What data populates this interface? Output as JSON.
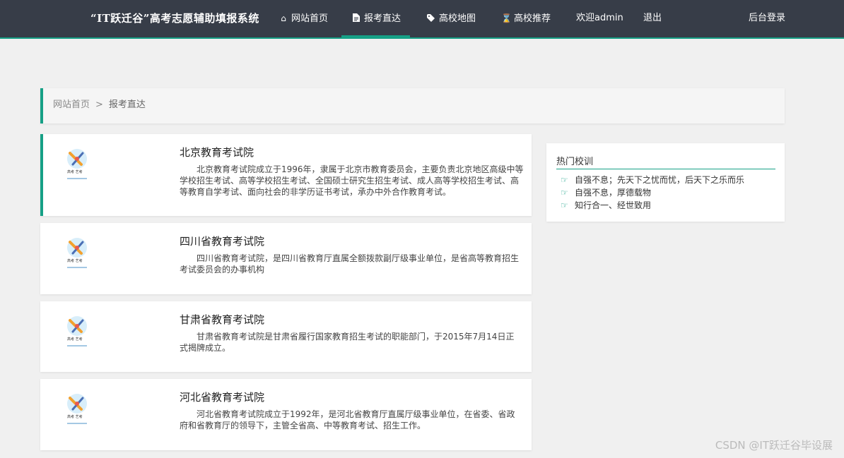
{
  "brand": "“IT跃迁谷”高考志愿辅助填报系统",
  "nav": [
    {
      "label": "网站首页",
      "icon": "home-icon"
    },
    {
      "label": "报考直达",
      "icon": "file-icon",
      "active": true
    },
    {
      "label": "高校地图",
      "icon": "tag-icon"
    },
    {
      "label": "高校推荐",
      "icon": "hourglass-icon"
    },
    {
      "label": "欢迎admin",
      "icon": ""
    },
    {
      "label": "退出",
      "icon": ""
    },
    {
      "label": "后台登录",
      "icon": ""
    }
  ],
  "breadcrumb": {
    "home": "网站首页",
    "separator": ">",
    "current": "报考直达"
  },
  "cards": [
    {
      "title": "北京教育考试院",
      "desc": "北京教育考试院成立于1996年，隶属于北京市教育委员会，主要负责北京地区高级中等学校招生考试、高等学校招生考试、全国硕士研究生招生考试、成人高等学校招生考试、高等教育自学考试、面向社会的非学历证书考试，承办中外合作教育考试。",
      "logo_text": "高考 艺考"
    },
    {
      "title": "四川省教育考试院",
      "desc": "四川省教育考试院，是四川省教育厅直属全额拨款副厅级事业单位，是省高等教育招生考试委员会的办事机构",
      "logo_text": "高考 艺考"
    },
    {
      "title": "甘肃省教育考试院",
      "desc": "甘肃省教育考试院是甘肃省履行国家教育招生考试的职能部门，于2015年7月14日正式揭牌成立。",
      "logo_text": "高考 艺考"
    },
    {
      "title": "河北省教育考试院",
      "desc": "河北省教育考试院成立于1992年，是河北省教育厅直属厅级事业单位，在省委、省政府和省教育厅的领导下，主管全省高、中等教育考试、招生工作。",
      "logo_text": "高考 艺考"
    }
  ],
  "sidebar": {
    "title": "热门校训",
    "items": [
      "自强不息；先天下之忧而忧，后天下之乐而乐",
      "自强不息，厚德载物",
      "知行合一、经世致用"
    ]
  },
  "watermark": "CSDN @IT跃迁谷毕设展",
  "colors": {
    "nav_bg": "#373d48",
    "accent": "#16a086",
    "page_bg": "#f0f0f0"
  }
}
